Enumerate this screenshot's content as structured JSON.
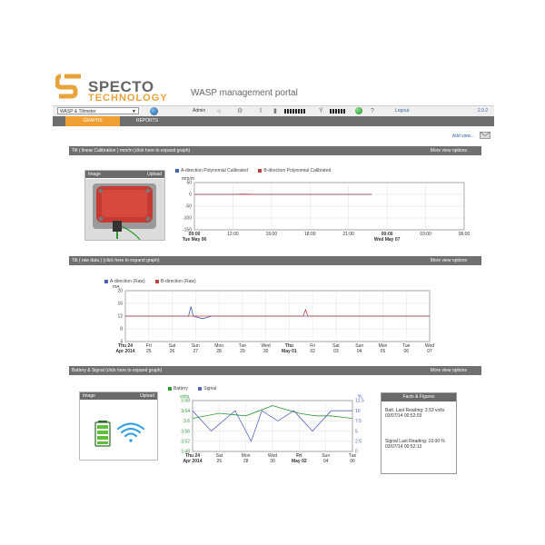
{
  "header": {
    "logo_line1": "SPECTO",
    "logo_line2": "TECHNOLOGY",
    "portal_title": "WASP management portal"
  },
  "toolbar": {
    "device_selected": "WASP & Tiltmeter",
    "user": "Admin",
    "logout": "Logout",
    "version": "2.0.2"
  },
  "tabs": [
    {
      "label": "GRAPHS",
      "active": true
    },
    {
      "label": "REPORTS",
      "active": false
    }
  ],
  "add_view": "Add view...",
  "sections": {
    "tilt_cal": {
      "title": "Tilt ( linear Calibration ) mm/m (click here to expand graph)",
      "more": "More view options"
    },
    "tilt_raw": {
      "title": "Tilt ( raw data ) (click here to expand graph)",
      "more": "More view options"
    },
    "battery": {
      "title": "Battery & Signal (click here to expand graph)",
      "more": "More view options"
    }
  },
  "image_panel": {
    "label": "Image",
    "upload": "Upload"
  },
  "facts": {
    "title": "Facts & Figures",
    "batt_line1": "Batt. Last Reading: 3.53 volts",
    "batt_line2": "03/07/14 00:52:03",
    "sig_line1": "Signal Last Reading: 10.00 %",
    "sig_line2": "03/07/14 00:52:13"
  },
  "colors": {
    "accent_orange": "#f0a030",
    "series_a": "#4060b0",
    "series_b": "#c04040",
    "battery": "#2e9a3a",
    "signal": "#5566bb"
  },
  "chart_data": [
    {
      "type": "line",
      "name": "tilt-calibrated",
      "ylabel": "mm/m",
      "ylim": [
        -150,
        50
      ],
      "yticks": [
        50,
        0,
        -50,
        -100,
        -150
      ],
      "x_ticks": [
        {
          "top": "09:00",
          "bottom": "Tue May 06"
        },
        {
          "top": "12:00",
          "bottom": ""
        },
        {
          "top": "15:00",
          "bottom": ""
        },
        {
          "top": "18:00",
          "bottom": ""
        },
        {
          "top": "21:00",
          "bottom": ""
        },
        {
          "top": "00:00",
          "bottom": "Wed May 07"
        },
        {
          "top": "03:00",
          "bottom": ""
        },
        {
          "top": "06:00",
          "bottom": ""
        }
      ],
      "series": [
        {
          "name": "A-direction Polynomial Calibrated",
          "color": "#4060b0",
          "x": [
            0,
            1,
            2,
            3,
            4,
            4.6
          ],
          "y": [
            0,
            0,
            0,
            0,
            0,
            0
          ]
        },
        {
          "name": "B-direction Polynomial Calibrated",
          "color": "#c04040",
          "x": [
            0,
            1,
            1.3,
            1.6,
            2,
            4.6
          ],
          "y": [
            0,
            0,
            1,
            0,
            0,
            0
          ]
        }
      ]
    },
    {
      "type": "line",
      "name": "tilt-raw",
      "ylabel": "mA",
      "ylim": [
        4,
        20
      ],
      "yticks": [
        20,
        16,
        12,
        8,
        4
      ],
      "x_ticks": [
        {
          "top": "Thu 24",
          "bottom": "Apr 2014"
        },
        {
          "top": "Fri",
          "bottom": "25"
        },
        {
          "top": "Sat",
          "bottom": "26"
        },
        {
          "top": "Sun",
          "bottom": "27"
        },
        {
          "top": "Mon",
          "bottom": "28"
        },
        {
          "top": "Tue",
          "bottom": "29"
        },
        {
          "top": "Wed",
          "bottom": "30"
        },
        {
          "top": "Thu",
          "bottom": "May 01"
        },
        {
          "top": "Fri",
          "bottom": "02"
        },
        {
          "top": "Sat",
          "bottom": "03"
        },
        {
          "top": "Sun",
          "bottom": "04"
        },
        {
          "top": "Mon",
          "bottom": "05"
        },
        {
          "top": "Tue",
          "bottom": "06"
        },
        {
          "top": "Wed",
          "bottom": "07"
        }
      ],
      "series": [
        {
          "name": "A-direction (Raw)",
          "color": "#4060b0",
          "x": [
            0,
            1,
            2,
            2.7,
            2.8,
            2.9,
            3.3,
            3.7,
            4,
            5,
            6,
            7,
            7.5,
            8,
            9,
            10,
            11,
            12,
            13
          ],
          "y": [
            12,
            12,
            12,
            12,
            15,
            12,
            11.2,
            12,
            12,
            12,
            12,
            12,
            12,
            12,
            12,
            12,
            12,
            12,
            12
          ]
        },
        {
          "name": "B-direction (Raw)",
          "color": "#c04040",
          "x": [
            0,
            1,
            2,
            4,
            6,
            7.6,
            7.7,
            7.8,
            9,
            11,
            13
          ],
          "y": [
            12,
            12,
            12,
            12,
            12,
            12,
            14,
            12,
            12,
            12,
            12
          ]
        }
      ]
    },
    {
      "type": "line",
      "name": "battery-signal",
      "ylabel": "volts",
      "y2label": "%",
      "ylim": [
        3.48,
        3.68
      ],
      "yticks": [
        3.68,
        3.64,
        3.6,
        3.56,
        3.52,
        3.48
      ],
      "y2lim": [
        0,
        12.5
      ],
      "y2ticks": [
        12.5,
        10,
        7.5,
        5,
        2.5,
        0
      ],
      "x_ticks": [
        {
          "top": "Thu 24",
          "bottom": "Apr 2014"
        },
        {
          "top": "Sat",
          "bottom": "26"
        },
        {
          "top": "Mon",
          "bottom": "28"
        },
        {
          "top": "Wed",
          "bottom": "30"
        },
        {
          "top": "Fri",
          "bottom": "May 02"
        },
        {
          "top": "Sun",
          "bottom": "04"
        },
        {
          "top": "Tue",
          "bottom": "06"
        }
      ],
      "series": [
        {
          "name": "Battery",
          "color": "#2e9a3a",
          "axis": "left",
          "x": [
            0,
            1,
            2,
            3,
            4,
            4.6,
            5.2,
            6
          ],
          "y": [
            3.61,
            3.63,
            3.62,
            3.66,
            3.63,
            3.62,
            3.62,
            3.61
          ]
        },
        {
          "name": "Signal",
          "color": "#5566bb",
          "axis": "right",
          "x": [
            0,
            0.7,
            1.6,
            2.2,
            2.6,
            3.2,
            3.8,
            4.5,
            5.2,
            5.8,
            6
          ],
          "y": [
            10,
            5,
            10,
            2.5,
            10,
            7.5,
            10,
            5,
            10,
            10,
            10
          ]
        }
      ]
    }
  ]
}
